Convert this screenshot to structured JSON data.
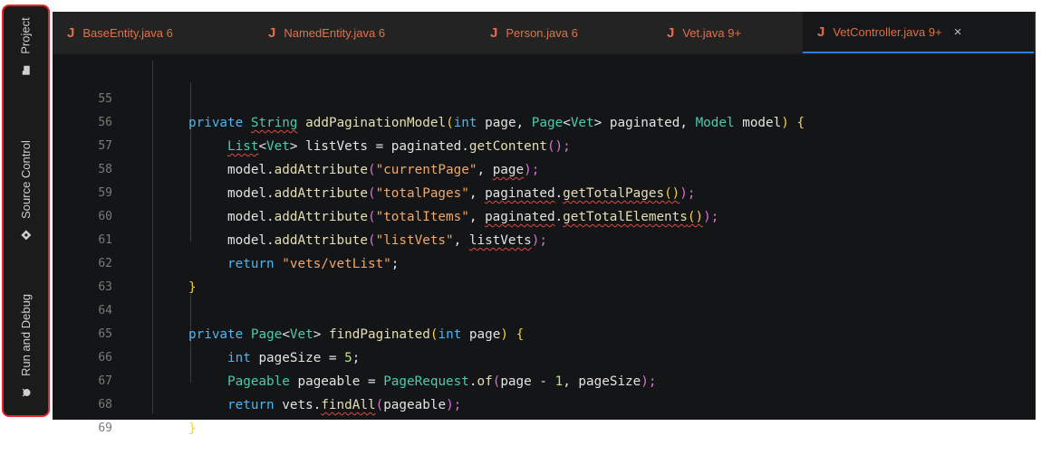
{
  "activity_bar": [
    {
      "label": "Project",
      "icon": "folder-icon"
    },
    {
      "label": "Source Control",
      "icon": "source-control-icon"
    },
    {
      "label": "Run and Debug",
      "icon": "debug-icon"
    }
  ],
  "tabs": [
    {
      "letter": "J",
      "name": "BaseEntity.java",
      "count": "6"
    },
    {
      "letter": "J",
      "name": "NamedEntity.java",
      "count": "6"
    },
    {
      "letter": "J",
      "name": "Person.java",
      "count": "6"
    },
    {
      "letter": "J",
      "name": "Vet.java",
      "count": "9+"
    },
    {
      "letter": "J",
      "name": "VetController.java",
      "count": "9+",
      "close": "×"
    }
  ],
  "line_numbers": [
    "55",
    "56",
    "57",
    "58",
    "59",
    "60",
    "61",
    "62",
    "63",
    "64",
    "65",
    "66",
    "67",
    "68",
    "69"
  ],
  "code": {
    "l55": [
      "private",
      "String",
      "addPaginationModel",
      "(",
      "int",
      "page, ",
      "Page",
      "<",
      "Vet",
      ">",
      "paginated, ",
      "Model",
      "model",
      ")",
      " {"
    ],
    "l56": [
      "List",
      "<",
      "Vet",
      "> ",
      "listVets",
      " = ",
      "paginated",
      "getContent",
      "();"
    ],
    "l57": [
      "model",
      "addAttribute",
      "(",
      "\"currentPage\"",
      ", ",
      "page",
      ");"
    ],
    "l58": [
      "model",
      "addAttribute",
      "(",
      "\"totalPages\"",
      ", ",
      "paginated",
      "getTotalPages",
      "()",
      ");"
    ],
    "l59": [
      "model",
      "addAttribute",
      "(",
      "\"totalItems\"",
      ", ",
      "paginated",
      "getTotalElements",
      "()",
      ");"
    ],
    "l60": [
      "model",
      "addAttribute",
      "(",
      "\"listVets\"",
      ", ",
      "listVets",
      ");"
    ],
    "l61": [
      "return",
      "\"vets/vetList\"",
      ";"
    ],
    "l62": [
      "}"
    ],
    "l64": [
      "private",
      "Page",
      "<",
      "Vet",
      "> ",
      "findPaginated",
      "(",
      "int",
      "page",
      ")",
      " {"
    ],
    "l65": [
      "int",
      "pageSize",
      " = ",
      "5",
      ";"
    ],
    "l66": [
      "Pageable",
      "pageable",
      " = ",
      "PageRequest",
      "of",
      "(",
      "page - ",
      "1",
      ", ",
      "pageSize",
      ");"
    ],
    "l67": [
      "return",
      "vets",
      "findAll",
      "(",
      "pageable",
      ");"
    ],
    "l68": [
      "}"
    ]
  }
}
